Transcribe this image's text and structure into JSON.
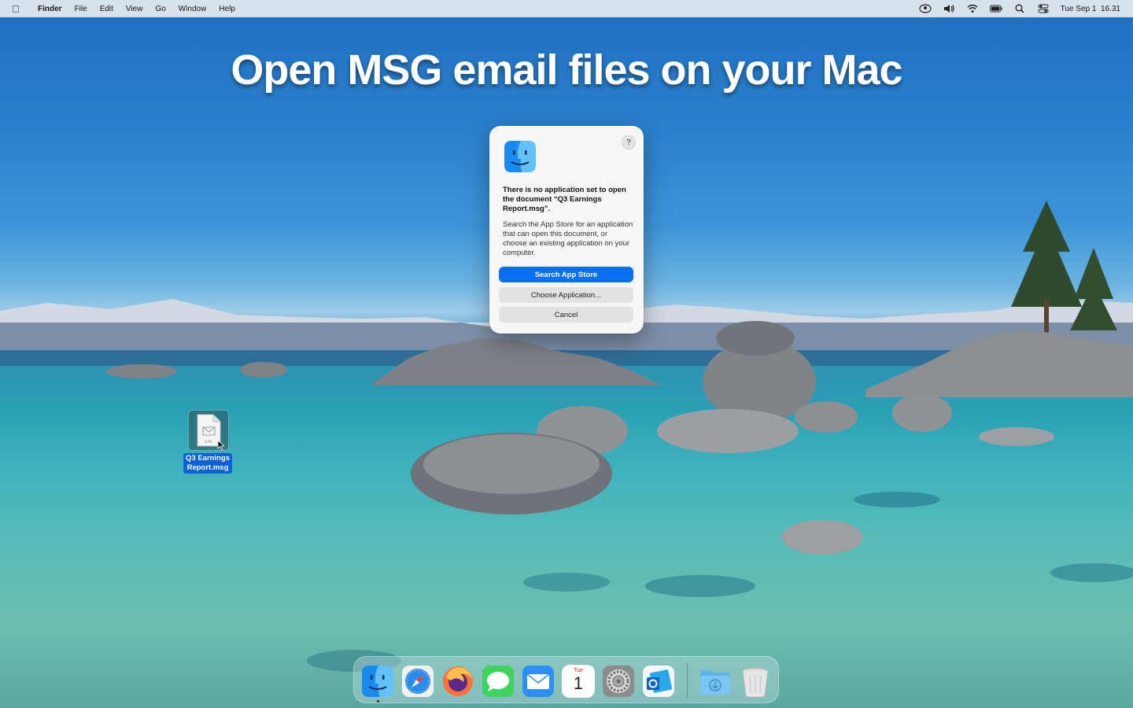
{
  "menubar": {
    "apple_icon": "apple-logo-icon",
    "app_name": "Finder",
    "items": [
      "File",
      "Edit",
      "View",
      "Go",
      "Window",
      "Help"
    ],
    "status_icons": [
      "user-account-icon",
      "volume-icon",
      "wifi-icon",
      "battery-icon",
      "spotlight-search-icon",
      "control-center-icon"
    ],
    "datetime": "Tue Sep 1  16.31"
  },
  "headline": "Open MSG email files on your Mac",
  "dialog": {
    "icon": "finder-icon",
    "help_label": "?",
    "title": "There is no application set to open the document “Q3 Earnings Report.msg”.",
    "body": "Search the App Store for an application that can open this document, or choose an existing application on your computer.",
    "primary_button": "Search App Store",
    "choose_button": "Choose Application...",
    "cancel_button": "Cancel",
    "accent_color": "#0b6ff2"
  },
  "desktop_file": {
    "label_line1": "Q3 Earnings",
    "label_line2": "Report.msg",
    "icon": "eml-document-icon",
    "icon_badge": "EML"
  },
  "dock": {
    "apps": [
      "Finder",
      "Safari",
      "Firefox",
      "Messages",
      "Mail",
      "Calendar",
      "System Preferences",
      "Outlook",
      "Downloads",
      "Trash"
    ],
    "calendar_month": "Tue",
    "calendar_day": "1"
  }
}
